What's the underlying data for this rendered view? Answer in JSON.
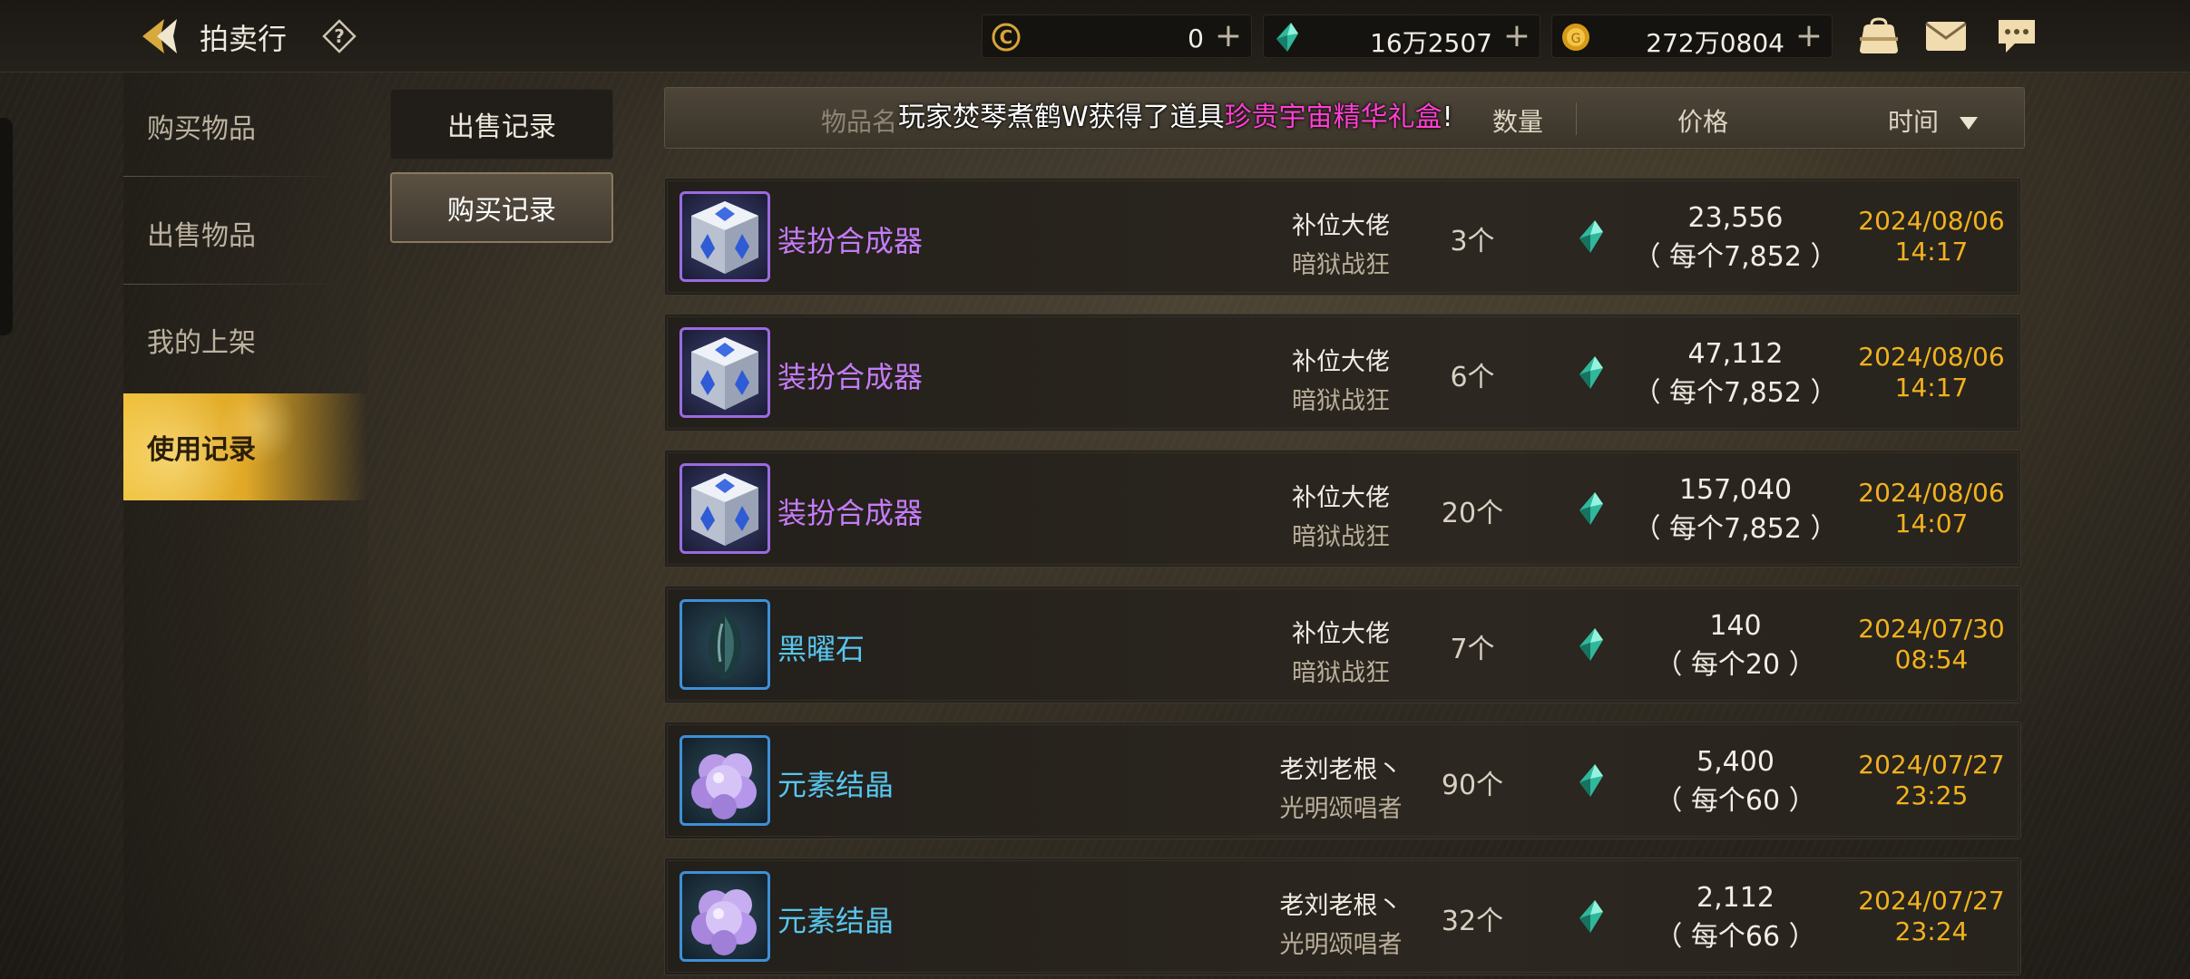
{
  "header": {
    "title": "拍卖行",
    "currencies": [
      {
        "icon": "coupon-c-icon",
        "value": "0"
      },
      {
        "icon": "green-gem-icon",
        "value": "16万2507"
      },
      {
        "icon": "gold-coin-icon",
        "value": "272万0804"
      }
    ],
    "icons": [
      "bag-icon",
      "mail-icon",
      "chat-icon"
    ]
  },
  "sidebar": {
    "items": [
      {
        "label": "购买物品",
        "active": false
      },
      {
        "label": "出售物品",
        "active": false
      },
      {
        "label": "我的上架",
        "active": false
      },
      {
        "label": "使用记录",
        "active": true
      }
    ]
  },
  "subtabs": [
    {
      "label": "出售记录",
      "active": false
    },
    {
      "label": "购买记录",
      "active": true
    }
  ],
  "table": {
    "col_name": "物品名",
    "col_qty": "数量",
    "col_price": "价格",
    "col_time": "时间"
  },
  "ticker": {
    "prefix": "玩家焚琴煮鹤W获得了道具",
    "item": "珍贵宇宙精华礼盒",
    "suffix": "!"
  },
  "rows": [
    {
      "item": "装扮合成器",
      "rarity": "purple",
      "icon": "cube-icon",
      "seller": "补位大佬",
      "seller_class": "暗狱战狂",
      "qty": "3个",
      "total": "23,556",
      "each": "（ 每个7,852 ）",
      "date": "2024/08/06",
      "time": "14:17"
    },
    {
      "item": "装扮合成器",
      "rarity": "purple",
      "icon": "cube-icon",
      "seller": "补位大佬",
      "seller_class": "暗狱战狂",
      "qty": "6个",
      "total": "47,112",
      "each": "（ 每个7,852 ）",
      "date": "2024/08/06",
      "time": "14:17"
    },
    {
      "item": "装扮合成器",
      "rarity": "purple",
      "icon": "cube-icon",
      "seller": "补位大佬",
      "seller_class": "暗狱战狂",
      "qty": "20个",
      "total": "157,040",
      "each": "（ 每个7,852 ）",
      "date": "2024/08/06",
      "time": "14:07"
    },
    {
      "item": "黑曜石",
      "rarity": "blue",
      "icon": "obsidian-icon",
      "seller": "补位大佬",
      "seller_class": "暗狱战狂",
      "qty": "7个",
      "total": "140",
      "each": "（ 每个20 ）",
      "date": "2024/07/30",
      "time": "08:54"
    },
    {
      "item": "元素结晶",
      "rarity": "blue",
      "icon": "crystal-cluster-icon",
      "seller": "老刘老根丶",
      "seller_class": "光明颂唱者",
      "qty": "90个",
      "total": "5,400",
      "each": "（ 每个60 ）",
      "date": "2024/07/27",
      "time": "23:25"
    },
    {
      "item": "元素结晶",
      "rarity": "blue",
      "icon": "crystal-cluster-icon",
      "seller": "老刘老根丶",
      "seller_class": "光明颂唱者",
      "qty": "32个",
      "total": "2,112",
      "each": "（ 每个66 ）",
      "date": "2024/07/27",
      "time": "23:24"
    }
  ],
  "colors": {
    "accent_gold": "#f2b21e",
    "rarity_purple": "#c47cf5",
    "rarity_blue": "#58c6ee",
    "ticker_highlight": "#ff3fd1"
  }
}
